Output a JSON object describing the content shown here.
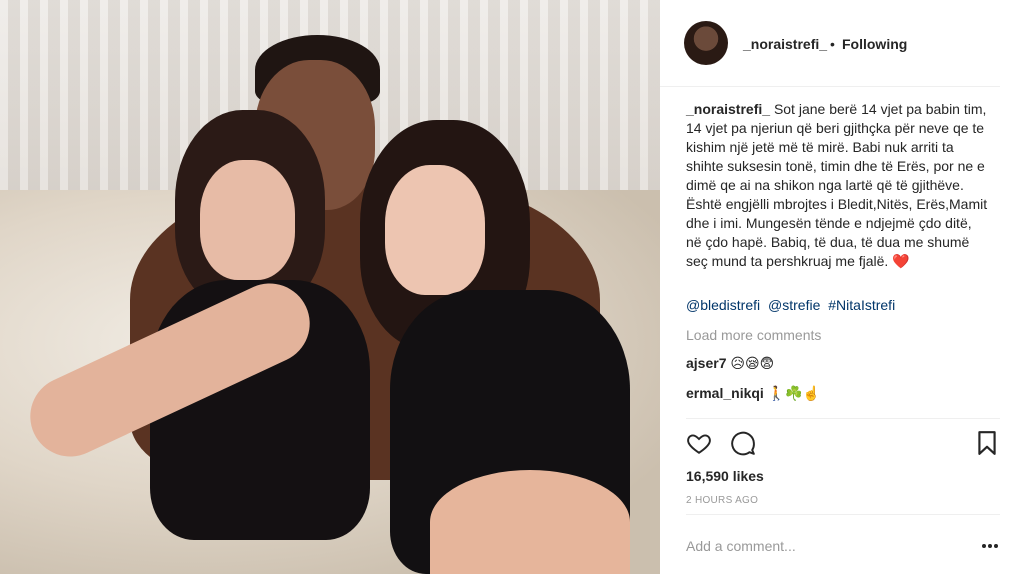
{
  "post": {
    "author": "_noraistrefi_",
    "dot": "•",
    "follow_status": "Following",
    "caption_author": "_noraistrefi_",
    "caption_text": "Sot jane berë 14 vjet pa babin tim, 14 vjet pa njeriun që beri gjithçka për neve qe te kishim një jetë më të mirë. Babi nuk arriti ta shihte suksesin tonë, timin dhe të Erës, por ne e dimë qe ai na shikon nga lartë që të gjithëve. Është engjëlli mbrojtes i Bledit,Nitës, Erës,Mamit dhe i imi. Mungesën tënde e ndjejmë çdo ditë, në çdo hapë. Babiq, të dua, të dua me shumë seç mund ta pershkruaj me fjalë.",
    "caption_emoji": "❤️",
    "tags": [
      "@bledistrefi",
      "@strefie",
      "#NitaIstrefi"
    ],
    "load_more": "Load more comments",
    "comments": [
      {
        "user": "ajser7",
        "text": "😥😪😨"
      },
      {
        "user": "ermal_nikqi",
        "text": "🚶☘️☝️"
      }
    ],
    "likes": "16,590 likes",
    "time": "2 HOURS AGO",
    "add_comment_placeholder": "Add a comment..."
  },
  "icons": {
    "like": "heart-icon",
    "comment": "comment-icon",
    "save": "bookmark-icon",
    "more": "more-options-icon"
  },
  "colors": {
    "text": "#262626",
    "muted": "#999999",
    "link": "#003569",
    "heart": "#e0142b",
    "divider": "#efefef"
  }
}
